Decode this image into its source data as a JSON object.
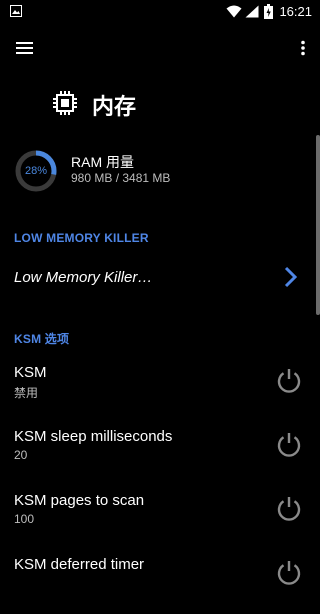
{
  "status_bar": {
    "time": "16:21"
  },
  "screen": {
    "title": "内存"
  },
  "ram": {
    "percent": 28,
    "percent_label": "28%",
    "label": "RAM 用量",
    "value": "980 MB / 3481 MB"
  },
  "sections": {
    "lmk_header": "LOW MEMORY KILLER",
    "ksm_header": "KSM 选项"
  },
  "lmk_item": {
    "label": "Low Memory Killer…"
  },
  "ksm_items": [
    {
      "title": "KSM",
      "subtitle": "禁用"
    },
    {
      "title": "KSM sleep milliseconds",
      "subtitle": "20"
    },
    {
      "title": "KSM pages to scan",
      "subtitle": "100"
    },
    {
      "title": "KSM deferred timer",
      "subtitle": ""
    }
  ],
  "colors": {
    "accent": "#4f86e6",
    "background": "#000000",
    "icon_gray": "#8a8a8a"
  }
}
